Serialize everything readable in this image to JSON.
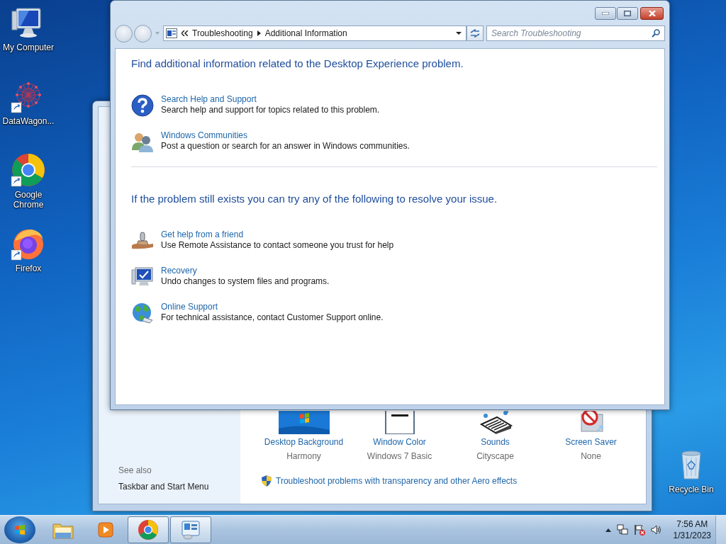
{
  "desktop_icons": [
    {
      "kind": "computer",
      "label": "My Computer",
      "shortcut": false
    },
    {
      "kind": "datawagon",
      "label": "DataWagon...",
      "shortcut": true
    },
    {
      "kind": "chrome",
      "label": "Google Chrome",
      "shortcut": true
    },
    {
      "kind": "firefox",
      "label": "Firefox",
      "shortcut": true
    }
  ],
  "recycle_bin": {
    "label": "Recycle Bin"
  },
  "back_window": {
    "see_also": {
      "heading": "See also",
      "links": [
        "Taskbar and Start Menu"
      ]
    },
    "items": [
      {
        "kind": "background",
        "title": "Desktop Background",
        "value": "Harmony"
      },
      {
        "kind": "color",
        "title": "Window Color",
        "value": "Windows 7 Basic"
      },
      {
        "kind": "sounds",
        "title": "Sounds",
        "value": "Cityscape"
      },
      {
        "kind": "saver",
        "title": "Screen Saver",
        "value": "None"
      }
    ],
    "troubleshoot_link": "Troubleshoot problems with transparency and other Aero effects"
  },
  "front_window": {
    "breadcrumb": [
      "Troubleshooting",
      "Additional Information"
    ],
    "search": {
      "placeholder": "Search Troubleshooting"
    },
    "sections": [
      {
        "heading": "Find additional information related to the Desktop Experience problem.",
        "items": [
          {
            "kind": "help",
            "title": "Search Help and Support",
            "description": "Search help and support for topics related to this problem."
          },
          {
            "kind": "community",
            "title": "Windows Communities",
            "description": "Post a question or search for an answer in Windows communities."
          }
        ]
      },
      {
        "heading": "If the problem still exists you can try any of the following to resolve your issue.",
        "items": [
          {
            "kind": "friend",
            "title": "Get help from a friend",
            "description": "Use Remote Assistance to contact someone you trust for help"
          },
          {
            "kind": "recovery",
            "title": "Recovery",
            "description": "Undo changes to system files and programs."
          },
          {
            "kind": "online",
            "title": "Online Support",
            "description": "For technical assistance, contact Customer Support online."
          }
        ]
      }
    ]
  },
  "taskbar": {
    "apps": [
      {
        "kind": "explorer",
        "active": false
      },
      {
        "kind": "media",
        "active": false
      },
      {
        "kind": "chrome",
        "active": true
      },
      {
        "kind": "control",
        "active": true
      }
    ],
    "time": "7:56 AM",
    "date": "1/31/2023"
  }
}
